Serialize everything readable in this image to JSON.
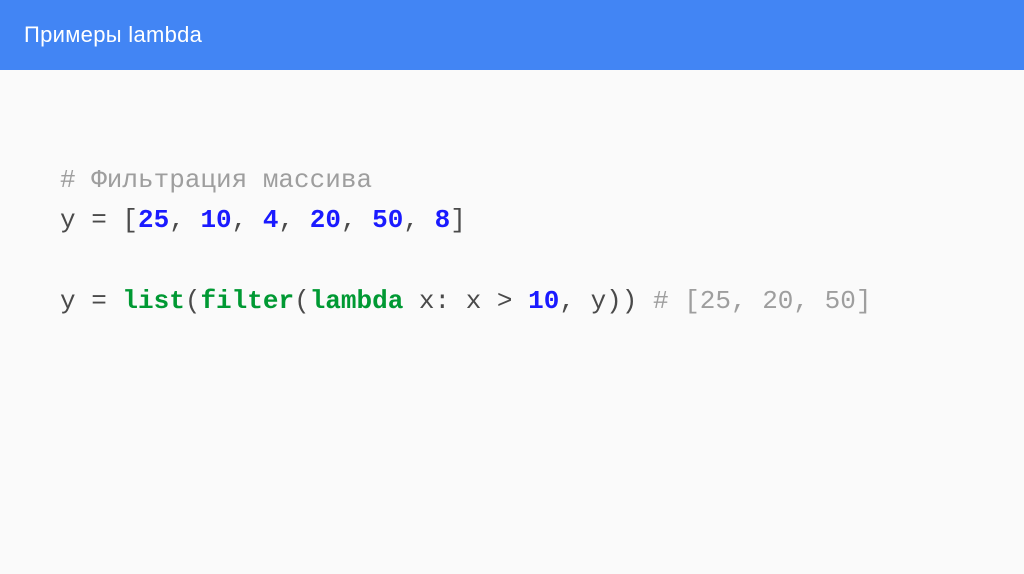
{
  "header": {
    "title": "Примеры lambda"
  },
  "code": {
    "line1_comment": "# Фильтрация массива",
    "line2_a": "y = [",
    "line2_n1": "25",
    "line2_s1": ", ",
    "line2_n2": "10",
    "line2_s2": ", ",
    "line2_n3": "4",
    "line2_s3": ", ",
    "line2_n4": "20",
    "line2_s4": ", ",
    "line2_n5": "50",
    "line2_s5": ", ",
    "line2_n6": "8",
    "line2_b": "]",
    "line3_space": " ",
    "line4_a": "y = ",
    "line4_kw1": "list",
    "line4_b": "(",
    "line4_kw2": "filter",
    "line4_c": "(",
    "line4_kw3": "lambda",
    "line4_d": " x: x > ",
    "line4_n1": "10",
    "line4_e": ", y)) ",
    "line4_comment": "# [25, 20, 50]"
  }
}
